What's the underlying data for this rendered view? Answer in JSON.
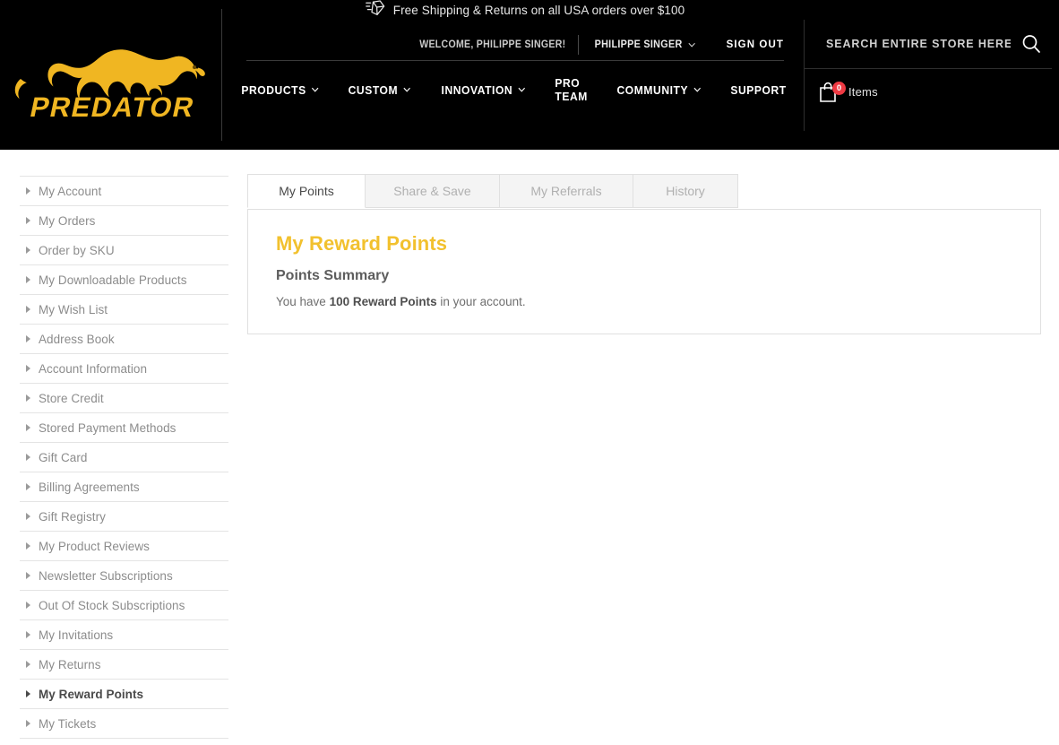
{
  "header": {
    "shipping_banner": {
      "icon": "fast-shipping-box-icon",
      "text": "Free Shipping & Returns on all USA orders over $100"
    },
    "welcome_text": "WELCOME, PHILIPPE SINGER!",
    "account_menu_label": "PHILIPPE SINGER",
    "account_menu_icon": "chevron-down-icon",
    "sign_out_label": "SIGN OUT",
    "logo": {
      "brand": "PREDATOR",
      "icon": "panther-logo-icon",
      "color": "#f0b622"
    },
    "search": {
      "placeholder": "SEARCH ENTIRE STORE HERE...",
      "value": "",
      "icon": "search-icon"
    },
    "cart": {
      "icon": "shopping-bag-icon",
      "count": "0",
      "label": "Items",
      "badge_color": "#ee3a43"
    },
    "nav": [
      {
        "label": "PRODUCTS",
        "has_caret": true
      },
      {
        "label": "CUSTOM",
        "has_caret": true
      },
      {
        "label": "INNOVATION",
        "has_caret": true
      },
      {
        "label": "PRO TEAM",
        "has_caret": false
      },
      {
        "label": "COMMUNITY",
        "has_caret": true
      },
      {
        "label": "SUPPORT",
        "has_caret": false
      }
    ]
  },
  "sidebar": {
    "items": [
      {
        "label": "My Account",
        "active": false
      },
      {
        "label": "My Orders",
        "active": false
      },
      {
        "label": "Order by SKU",
        "active": false
      },
      {
        "label": "My Downloadable Products",
        "active": false
      },
      {
        "label": "My Wish List",
        "active": false
      },
      {
        "label": "Address Book",
        "active": false
      },
      {
        "label": "Account Information",
        "active": false
      },
      {
        "label": "Store Credit",
        "active": false
      },
      {
        "label": "Stored Payment Methods",
        "active": false
      },
      {
        "label": "Gift Card",
        "active": false
      },
      {
        "label": "Billing Agreements",
        "active": false
      },
      {
        "label": "Gift Registry",
        "active": false
      },
      {
        "label": "My Product Reviews",
        "active": false
      },
      {
        "label": "Newsletter Subscriptions",
        "active": false
      },
      {
        "label": "Out Of Stock Subscriptions",
        "active": false
      },
      {
        "label": "My Invitations",
        "active": false
      },
      {
        "label": "My Returns",
        "active": false
      },
      {
        "label": "My Reward Points",
        "active": true
      },
      {
        "label": "My Tickets",
        "active": false
      }
    ]
  },
  "main": {
    "tabs": [
      {
        "label": "My Points",
        "active": true
      },
      {
        "label": "Share & Save",
        "active": false
      },
      {
        "label": "My Referrals",
        "active": false
      },
      {
        "label": "History",
        "active": false
      }
    ],
    "panel": {
      "title": "My Reward Points",
      "title_color": "#f2c12e",
      "subtitle": "Points Summary",
      "summary_prefix": "You have ",
      "summary_points": "100 Reward Points",
      "summary_suffix": " in your account."
    }
  }
}
